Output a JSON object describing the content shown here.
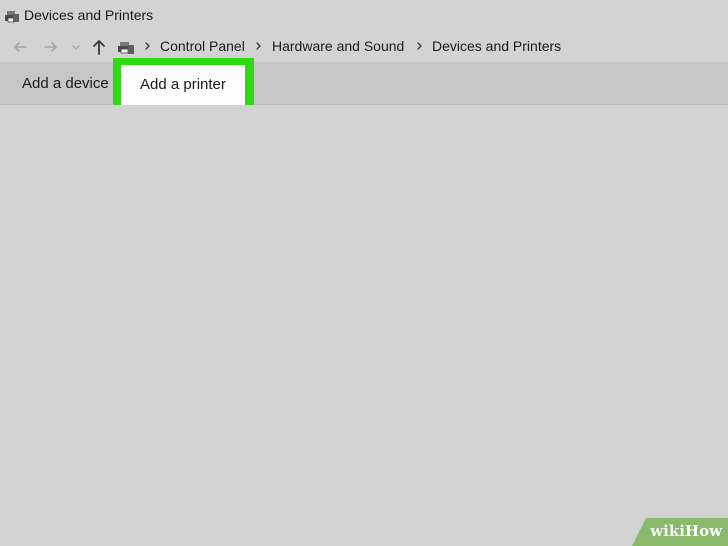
{
  "window": {
    "title": "Devices and Printers"
  },
  "address_bar": {
    "breadcrumbs": [
      "Control Panel",
      "Hardware and Sound",
      "Devices and Printers"
    ]
  },
  "command_bar": {
    "add_device_label": "Add a device",
    "add_printer_label": "Add a printer"
  },
  "watermark": {
    "prefix": "wiki",
    "suffix": "How"
  },
  "icons": {
    "title": "devices-printers-icon",
    "back": "back-arrow-icon",
    "forward": "forward-arrow-icon",
    "recent": "chevron-down-icon",
    "up": "up-arrow-icon",
    "breadcrumb_root": "devices-printers-icon",
    "separator": "chevron-right-icon"
  },
  "colors": {
    "highlight": "#2fd914",
    "background": "#d3d3d3",
    "command_bar": "#c6c6c6",
    "watermark": "#89b96a"
  }
}
